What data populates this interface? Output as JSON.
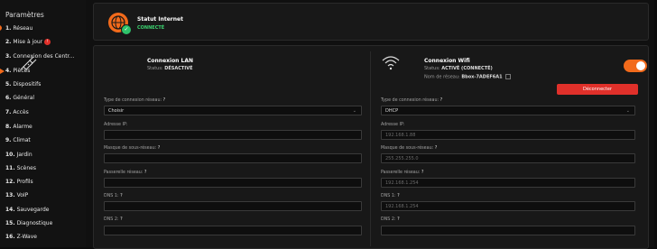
{
  "sidebar": {
    "title": "Paramètres",
    "items": [
      {
        "num": "1.",
        "label": "Réseau"
      },
      {
        "num": "2.",
        "label": "Mise à jour",
        "badge": "!"
      },
      {
        "num": "3.",
        "label": "Connexion des Centr..."
      },
      {
        "num": "4.",
        "label": "Pièces"
      },
      {
        "num": "5.",
        "label": "Dispositifs"
      },
      {
        "num": "6.",
        "label": "Général"
      },
      {
        "num": "7.",
        "label": "Accès"
      },
      {
        "num": "8.",
        "label": "Alarme"
      },
      {
        "num": "9.",
        "label": "Climat"
      },
      {
        "num": "10.",
        "label": "Jardin"
      },
      {
        "num": "11.",
        "label": "Scènes"
      },
      {
        "num": "12.",
        "label": "Profils"
      },
      {
        "num": "13.",
        "label": "VoIP"
      },
      {
        "num": "14.",
        "label": "Sauvegarde"
      },
      {
        "num": "15.",
        "label": "Diagnostique"
      },
      {
        "num": "16.",
        "label": "Z-Wave"
      }
    ]
  },
  "internet": {
    "title": "Statut Internet",
    "status": "CONNECTÉ"
  },
  "lan": {
    "title": "Connexion LAN",
    "status_label": "Status:",
    "status_value": "DÉSACTIVÉ",
    "conn_type_label": "Type de connexion réseau:",
    "conn_type_value": "Choisir",
    "ip_label": "Adresse IP:",
    "ip_value": "",
    "mask_label": "Masque de sous-réseau:",
    "mask_value": "",
    "gateway_label": "Passerelle réseau:",
    "gateway_value": "",
    "dns1_label": "DNS 1:",
    "dns1_value": "",
    "dns2_label": "DNS 2:",
    "dns2_value": ""
  },
  "wifi": {
    "title": "Connexion Wifi",
    "status_label": "Status:",
    "status_value": "ACTIVÉ (CONNECTÉ)",
    "network_label": "Nom de réseau:",
    "network_value": "Bbox-7ADEF6A1",
    "disconnect_label": "Déconnecter",
    "enabled": true,
    "conn_type_label": "Type de connexion réseau:",
    "conn_type_value": "DHCP",
    "ip_label": "Adresse IP:",
    "ip_value": "192.168.1.88",
    "mask_label": "Masque de sous-réseau:",
    "mask_value": "255.255.255.0",
    "gateway_label": "Passerelle réseau:",
    "gateway_value": "192.168.1.254",
    "dns1_label": "DNS 1:",
    "dns1_value": "192.168.1.254",
    "dns2_label": "DNS 2:",
    "dns2_value": ""
  },
  "colors": {
    "accent": "#f26a1b",
    "danger": "#e0302a",
    "success": "#2ec26a"
  }
}
